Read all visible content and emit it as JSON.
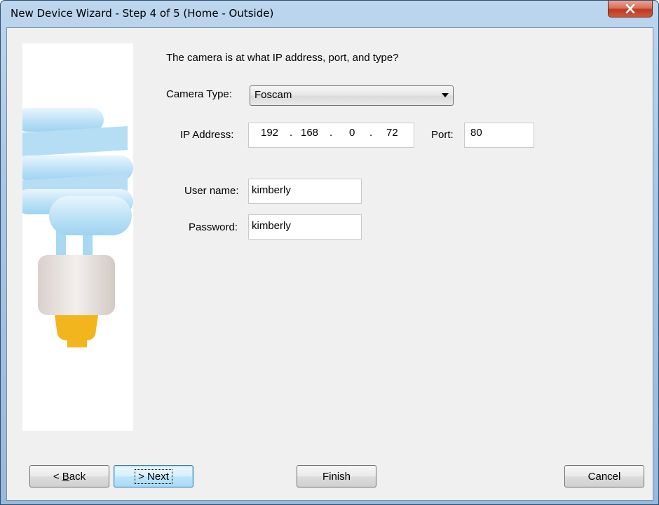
{
  "window": {
    "title": "New Device Wizard - Step 4 of 5 (Home - Outside)",
    "close_label": "X"
  },
  "prompt": "The camera is at what IP address, port, and type?",
  "camera_type": {
    "label": "Camera Type:",
    "value": "Foscam"
  },
  "ip_address": {
    "label": "IP Address:",
    "octets": [
      "192",
      "168",
      "0",
      "72"
    ],
    "separator": "."
  },
  "port": {
    "label": "Port:",
    "value": "80"
  },
  "user_name": {
    "label": "User name:",
    "value": "kimberly"
  },
  "password": {
    "label": "Password:",
    "value": "kimberly"
  },
  "buttons": {
    "back": {
      "prefix": "< ",
      "mnemonic": "B",
      "rest": "ack"
    },
    "next": "> Next",
    "finish": "Finish",
    "cancel": "Cancel"
  },
  "colors": {
    "bulb_glass": "#bfe3f7",
    "bulb_base": "#ede7e4",
    "bulb_tip": "#f2b51d"
  }
}
